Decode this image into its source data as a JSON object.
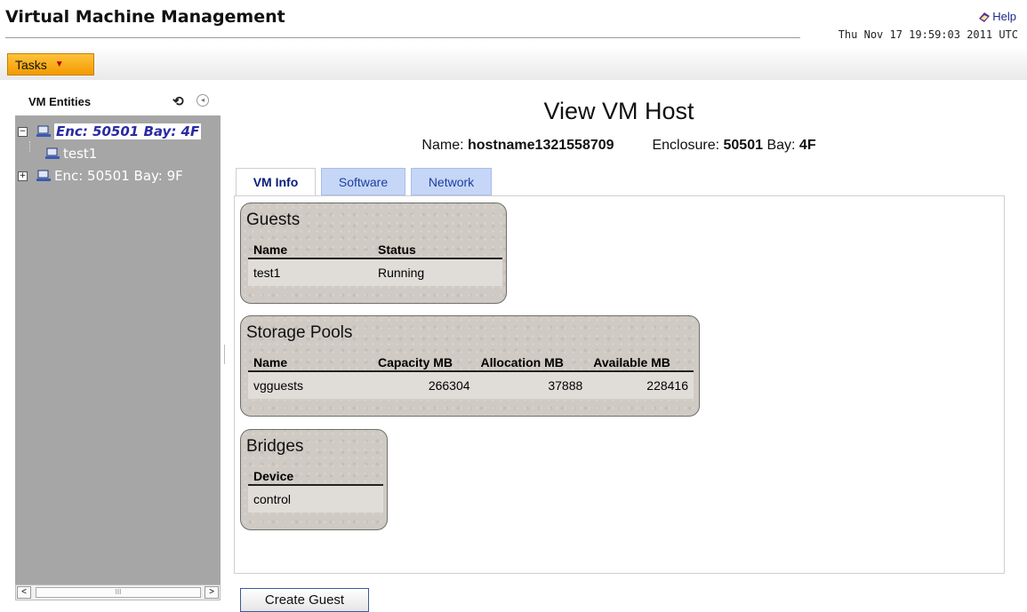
{
  "app": {
    "title": "Virtual Machine Management",
    "help_label": "Help",
    "timestamp": "Thu Nov 17 19:59:03 2011 UTC"
  },
  "toolbar": {
    "tasks_label": "Tasks"
  },
  "tree": {
    "title": "VM Entities",
    "refresh_glyph": "⟲",
    "collapse_glyph": "◂",
    "items": [
      {
        "label": "Enc: 50501 Bay: 4F",
        "expander": "−",
        "selected": true
      },
      {
        "label": "test1"
      },
      {
        "label": "Enc: 50501 Bay: 9F",
        "expander": "+",
        "selected": false
      }
    ],
    "scroll_left": "<",
    "scroll_right": ">",
    "scroll_thumb": "III"
  },
  "view": {
    "title": "View VM Host",
    "name_label": "Name:",
    "name_value": "hostname1321558709",
    "enclosure_label": "Enclosure:",
    "enclosure_value": "50501",
    "bay_label": "Bay:",
    "bay_value": "4F"
  },
  "tabs": [
    "VM Info",
    "Software",
    "Network"
  ],
  "guests": {
    "title": "Guests",
    "headers": [
      "Name",
      "Status"
    ],
    "rows": [
      [
        "test1",
        "Running"
      ]
    ]
  },
  "storage": {
    "title": "Storage Pools",
    "headers": [
      "Name",
      "Capacity MB",
      "Allocation MB",
      "Available MB"
    ],
    "rows": [
      [
        "vgguests",
        "266304",
        "37888",
        "228416"
      ]
    ]
  },
  "bridges": {
    "title": "Bridges",
    "headers": [
      "Device"
    ],
    "rows": [
      [
        "control"
      ]
    ]
  },
  "actions": {
    "create_guest_label": "Create Guest"
  },
  "colors": {
    "tasks_button": "#f39a00",
    "tree_background": "#a6a6a6",
    "tab_inactive": "#c6d6f7",
    "selected_text": "#2a2aa6"
  }
}
